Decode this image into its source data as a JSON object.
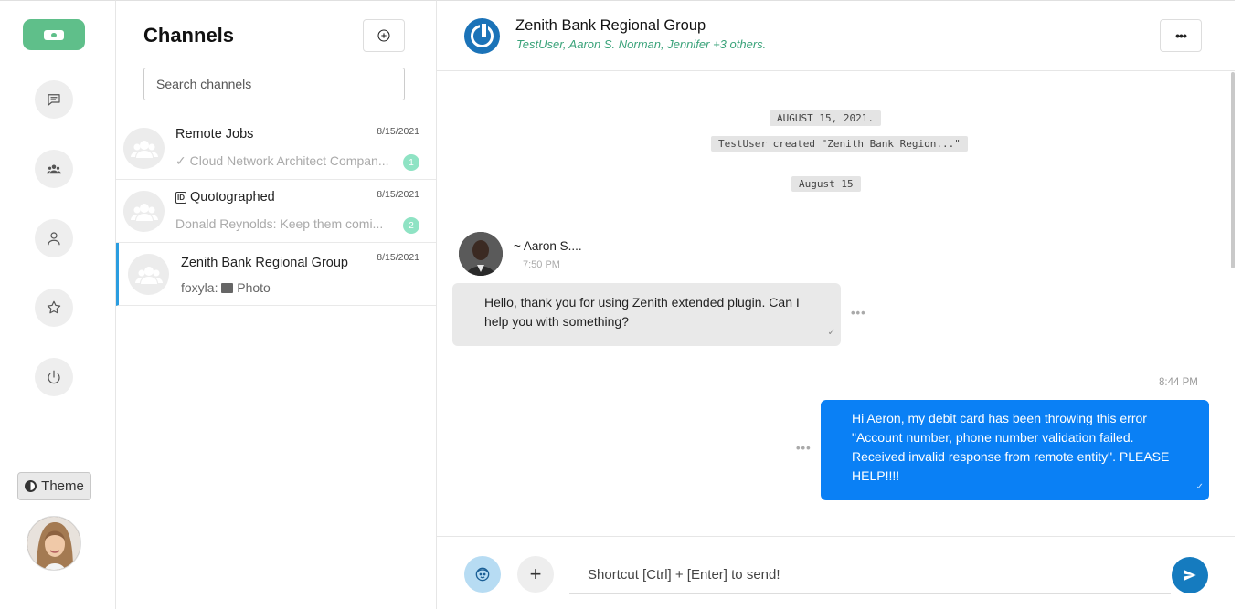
{
  "rail": {
    "icons": [
      "app-logo-icon",
      "chat-icon",
      "group-icon",
      "user-icon",
      "star-icon",
      "power-icon"
    ],
    "theme_label": "Theme",
    "accent_color": "#5fbf8a"
  },
  "channels": {
    "title": "Channels",
    "search_placeholder": "Search channels",
    "items": [
      {
        "name": "Remote Jobs",
        "date": "8/15/2021",
        "preview": "Cloud Network Architect Compan...",
        "badge": "1"
      },
      {
        "name": "Quotographed",
        "date": "8/15/2021",
        "preview": "Donald Reynolds: Keep them comi...",
        "badge": "2"
      },
      {
        "name": "Zenith Bank Regional Group",
        "date": "8/15/2021",
        "preview_prefix": "foxyla:",
        "preview": "Photo"
      }
    ]
  },
  "chat": {
    "group_name": "Zenith Bank Regional Group",
    "members": "TestUser, Aaron S. Norman, Jennifer +3 others.",
    "date_tag_1": "AUGUST 15, 2021.",
    "system_msg": "TestUser created \"Zenith Bank Region...\"",
    "date_tag_2": "August 15",
    "sender": "~ Aaron S....",
    "sender_time": "7:50 PM",
    "incoming_text": "Hello, thank you for using Zenith extended plugin. Can I help you with something?",
    "out_time": "8:44 PM",
    "outgoing_text": "Hi Aeron, my debit card has been throwing this error \"Account number, phone number validation failed. Received invalid response from remote entity\". PLEASE HELP!!!!",
    "message_options": "•••",
    "composer_placeholder": "Shortcut [Ctrl] + [Enter] to send!",
    "accent_color": "#0a80f5"
  }
}
